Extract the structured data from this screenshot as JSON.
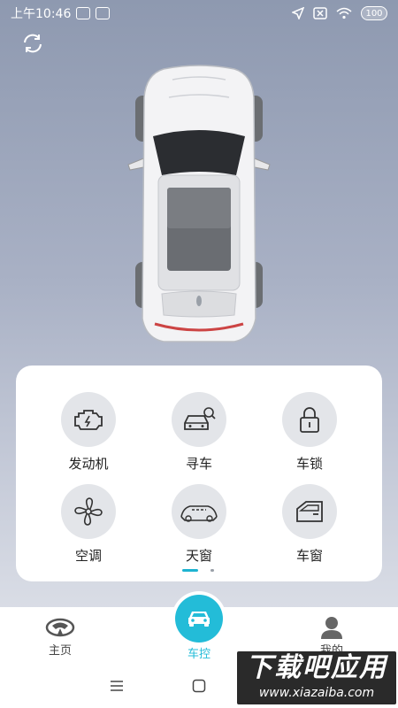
{
  "status_bar": {
    "time": "上午10:46",
    "battery": "100"
  },
  "controls": [
    {
      "label": "发动机",
      "icon": "engine-icon"
    },
    {
      "label": "寻车",
      "icon": "find-car-icon"
    },
    {
      "label": "车锁",
      "icon": "lock-icon"
    },
    {
      "label": "空调",
      "icon": "fan-icon"
    },
    {
      "label": "天窗",
      "icon": "sunroof-icon"
    },
    {
      "label": "车窗",
      "icon": "window-icon"
    }
  ],
  "pager": {
    "pages": 2,
    "current": 1
  },
  "tabs": [
    {
      "label": "主页",
      "icon": "brand-logo-icon",
      "active": false
    },
    {
      "label": "车控",
      "icon": "car-icon",
      "active": true
    },
    {
      "label": "我的",
      "icon": "person-icon",
      "active": false
    }
  ],
  "watermark": {
    "title": "下载吧应用",
    "url": "www.xiazaiba.com"
  },
  "colors": {
    "accent": "#23bcd8",
    "panel": "#ffffff",
    "icon_bg": "#e3e5e9"
  }
}
